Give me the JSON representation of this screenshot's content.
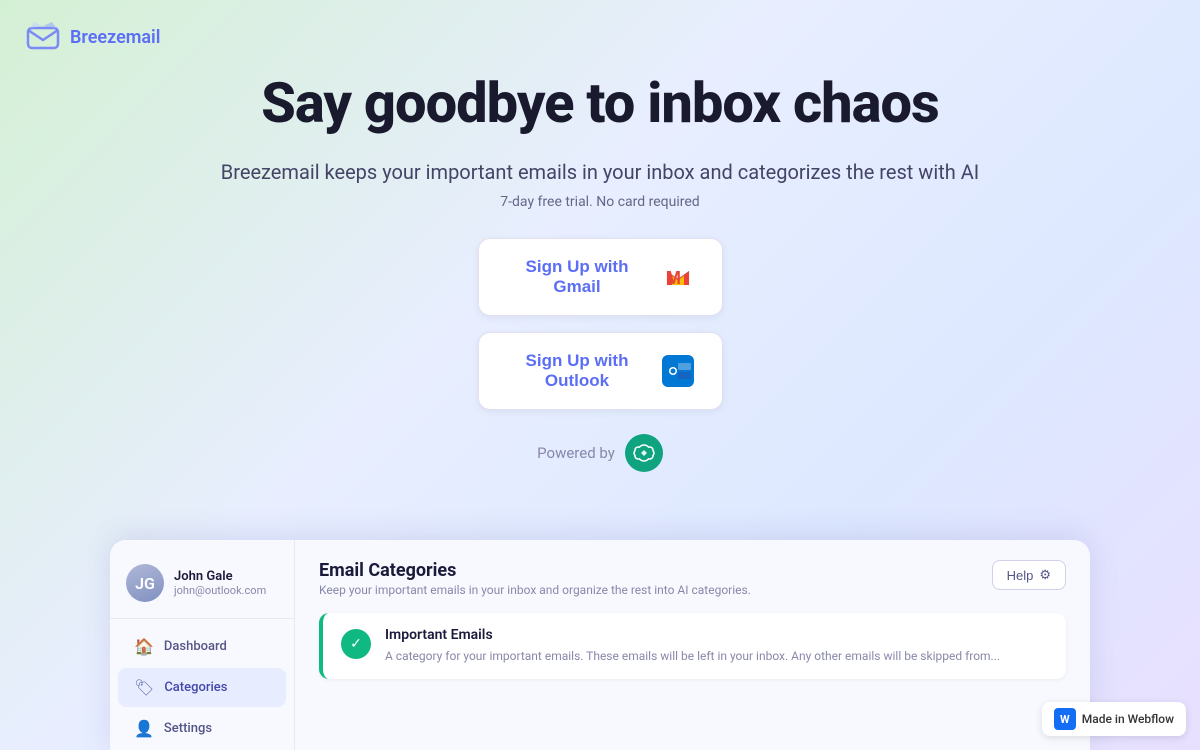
{
  "brand": {
    "name": "Breezemail",
    "logo_alt": "Breezemail logo"
  },
  "hero": {
    "title": "Say goodbye to inbox chaos",
    "subtitle": "Breezemail keeps your important emails in your inbox and categorizes the rest with AI",
    "trial_text": "7-day free trial. No card required",
    "gmail_button": "Sign Up with Gmail",
    "outlook_button": "Sign Up with Outlook",
    "powered_by": "Powered by"
  },
  "sidebar": {
    "user": {
      "name": "John Gale",
      "email": "john@outlook.com",
      "avatar_initials": "JG"
    },
    "items": [
      {
        "label": "Dashboard",
        "icon": "🏠",
        "active": false
      },
      {
        "label": "Categories",
        "icon": "🏷",
        "active": true
      },
      {
        "label": "Settings",
        "icon": "👤",
        "active": false
      }
    ]
  },
  "main": {
    "title": "Email Categories",
    "description": "Keep your important emails in your inbox and organize the rest into AI categories.",
    "help_label": "Help",
    "category": {
      "title": "Important Emails",
      "description": "A category for your important emails. These emails will be left in your inbox. Any other emails will be skipped from..."
    }
  },
  "webflow_badge": "Made in Webflow"
}
